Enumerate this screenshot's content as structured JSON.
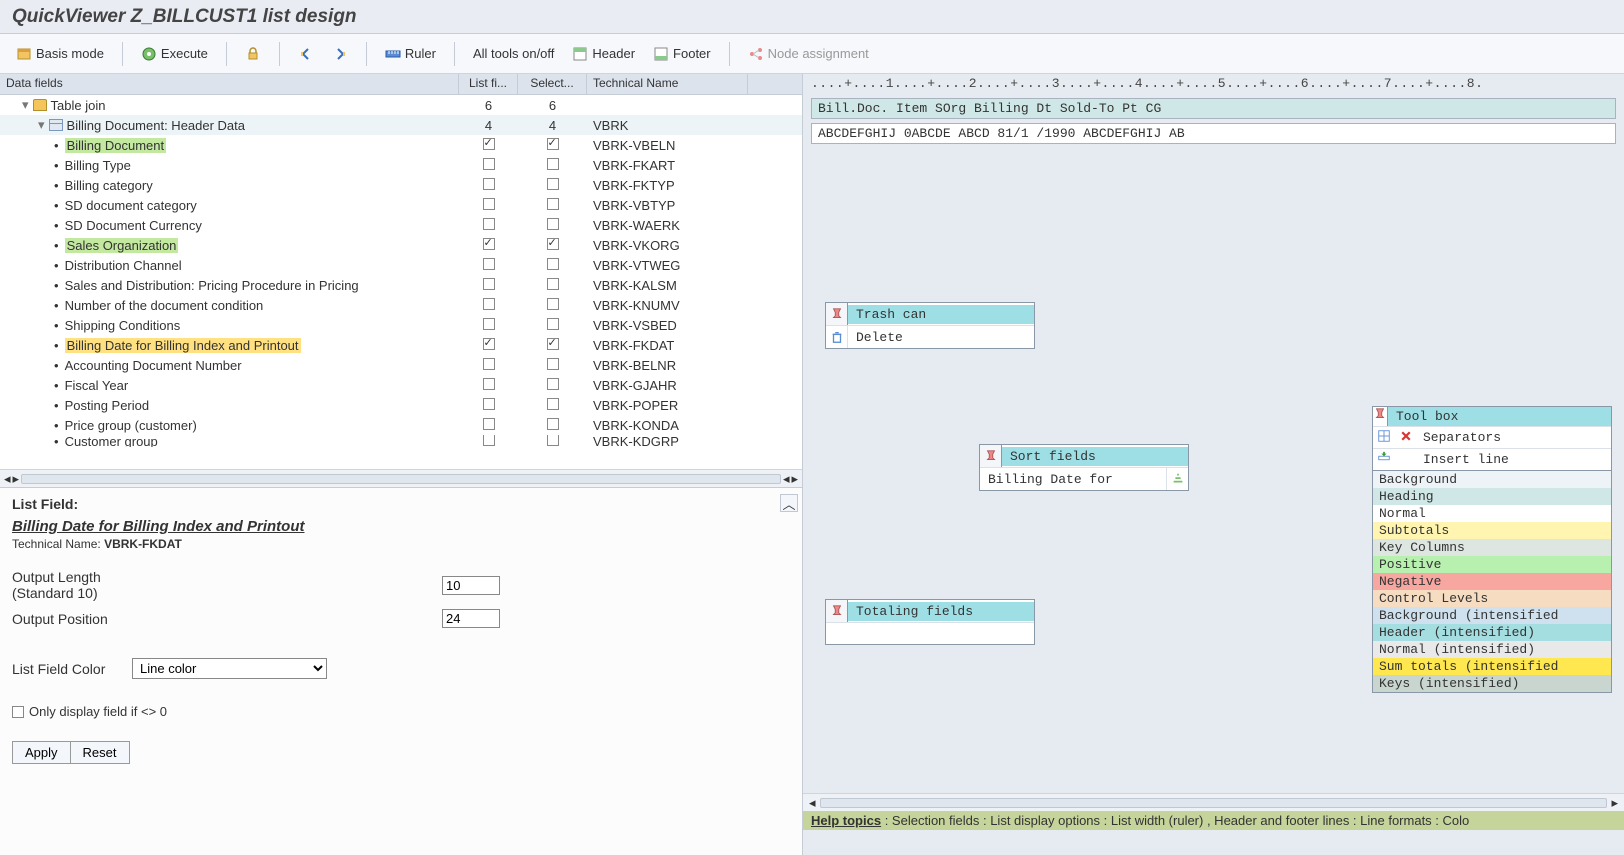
{
  "title": "QuickViewer Z_BILLCUST1 list design",
  "toolbar": {
    "basis_mode": "Basis mode",
    "execute": "Execute",
    "ruler": "Ruler",
    "all_tools": "All tools on/off",
    "header": "Header",
    "footer": "Footer",
    "node_assignment": "Node assignment"
  },
  "tree": {
    "col_data": "Data fields",
    "col_listfi": "List fi...",
    "col_select": "Select...",
    "col_tech": "Technical Name",
    "root": "Table join",
    "root_list": "6",
    "root_sel": "6",
    "hdr_row": "Billing Document: Header Data",
    "hdr_list": "4",
    "hdr_sel": "4",
    "hdr_tech": "VBRK",
    "rows": [
      {
        "label": "Billing Document",
        "hl": "green",
        "list": true,
        "sel": true,
        "tech": "VBRK-VBELN"
      },
      {
        "label": "Billing Type",
        "list": false,
        "sel": false,
        "tech": "VBRK-FKART"
      },
      {
        "label": "Billing category",
        "list": false,
        "sel": false,
        "tech": "VBRK-FKTYP"
      },
      {
        "label": "SD document category",
        "list": false,
        "sel": false,
        "tech": "VBRK-VBTYP"
      },
      {
        "label": "SD Document Currency",
        "list": false,
        "sel": false,
        "tech": "VBRK-WAERK"
      },
      {
        "label": "Sales Organization",
        "hl": "green",
        "list": true,
        "sel": true,
        "tech": "VBRK-VKORG"
      },
      {
        "label": "Distribution Channel",
        "list": false,
        "sel": false,
        "tech": "VBRK-VTWEG"
      },
      {
        "label": "Sales and Distribution: Pricing Procedure in Pricing",
        "list": false,
        "sel": false,
        "tech": "VBRK-KALSM"
      },
      {
        "label": "Number of the document condition",
        "list": false,
        "sel": false,
        "tech": "VBRK-KNUMV"
      },
      {
        "label": "Shipping Conditions",
        "list": false,
        "sel": false,
        "tech": "VBRK-VSBED"
      },
      {
        "label": "Billing Date for Billing Index and Printout",
        "hl": "yellow",
        "list": true,
        "sel": true,
        "tech": "VBRK-FKDAT"
      },
      {
        "label": "Accounting Document Number",
        "list": false,
        "sel": false,
        "tech": "VBRK-BELNR"
      },
      {
        "label": "Fiscal Year",
        "list": false,
        "sel": false,
        "tech": "VBRK-GJAHR"
      },
      {
        "label": "Posting Period",
        "list": false,
        "sel": false,
        "tech": "VBRK-POPER"
      },
      {
        "label": "Price group (customer)",
        "list": false,
        "sel": false,
        "tech": "VBRK-KONDA"
      },
      {
        "label": "Customer group",
        "list": false,
        "sel": false,
        "tech": "VBRK-KDGRP",
        "cut": true
      }
    ]
  },
  "details": {
    "heading": "List Field:",
    "field_name": "Billing Date for Billing Index and Printout",
    "tech_label": "Technical Name:",
    "tech_value": "VBRK-FKDAT",
    "output_length": "Output Length",
    "standard": "(Standard 10)",
    "output_length_val": "10",
    "output_position": "Output Position",
    "output_position_val": "24",
    "list_field_color": "List Field Color",
    "color_value": "Line color",
    "only_display": "Only display field if <> 0",
    "apply": "Apply",
    "reset": "Reset"
  },
  "preview": {
    "ruler": "....+....1....+....2....+....3....+....4....+....5....+....6....+....7....+....8.",
    "header_line": "Bill.Doc.  Item   SOrg Billing Dt Sold-To Pt CG",
    "body_line": "ABCDEFGHIJ 0ABCDE ABCD 81/1 /1990 ABCDEFGHIJ AB"
  },
  "trash": {
    "title": "Trash can",
    "delete": "Delete"
  },
  "sort": {
    "title": "Sort fields",
    "item": "Billing Date for"
  },
  "totaling": {
    "title": "Totaling fields"
  },
  "toolbox": {
    "title": "Tool box",
    "separators": "Separators",
    "insert_line": "Insert line",
    "colors": [
      {
        "label": "Background",
        "bg": "#eef3f7"
      },
      {
        "label": "Heading",
        "bg": "#cfe7e6"
      },
      {
        "label": "Normal",
        "bg": "#ffffff"
      },
      {
        "label": "Subtotals",
        "bg": "#fff4b0"
      },
      {
        "label": "Key Columns",
        "bg": "#dde6e0"
      },
      {
        "label": "Positive",
        "bg": "#b8f0b0"
      },
      {
        "label": "Negative",
        "bg": "#f7a6a0"
      },
      {
        "label": "Control Levels",
        "bg": "#f6ddc2"
      },
      {
        "label": "Background (intensified",
        "bg": "#cfe0ee"
      },
      {
        "label": "Header (intensified)",
        "bg": "#a4dee1"
      },
      {
        "label": "Normal (intensified)",
        "bg": "#e9e9e9"
      },
      {
        "label": "Sum totals (intensified",
        "bg": "#ffe74f"
      },
      {
        "label": "Keys (intensified)",
        "bg": "#c9d6cf"
      }
    ]
  },
  "help": {
    "label": "Help topics",
    "items": ": Selection fields : List display options : List width (ruler) , Header and footer lines : Line formats : Colo"
  }
}
